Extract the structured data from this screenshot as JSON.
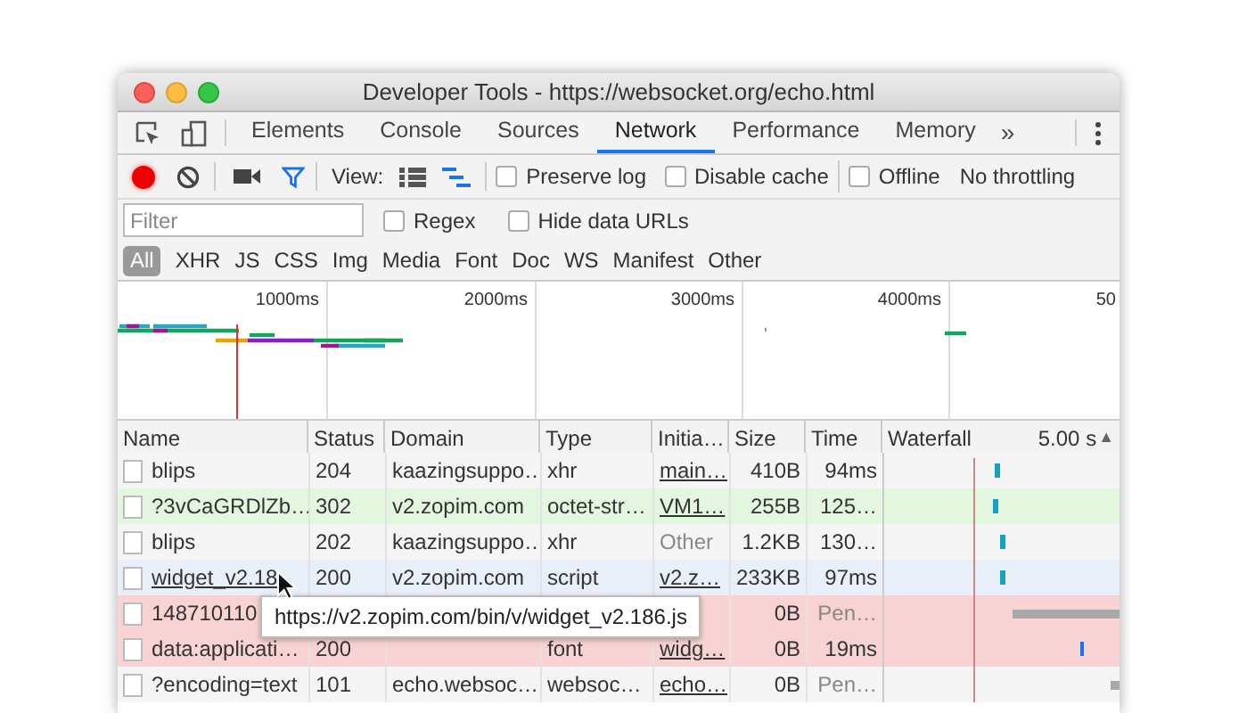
{
  "window": {
    "title": "Developer Tools - https://websocket.org/echo.html"
  },
  "tabs": [
    {
      "label": "Elements",
      "selected": false
    },
    {
      "label": "Console",
      "selected": false
    },
    {
      "label": "Sources",
      "selected": false
    },
    {
      "label": "Network",
      "selected": true
    },
    {
      "label": "Performance",
      "selected": false
    },
    {
      "label": "Memory",
      "selected": false
    }
  ],
  "more_tabs": "»",
  "toolbar": {
    "recording": true,
    "filter_on": true,
    "view_label": "View:",
    "large_rows": false,
    "overview": true,
    "checkboxes": [
      {
        "label": "Preserve log",
        "checked": false
      },
      {
        "label": "Disable cache",
        "checked": false
      },
      {
        "label": "Offline",
        "checked": false
      }
    ],
    "throttling": "No throttling"
  },
  "filter": {
    "placeholder": "Filter",
    "options": [
      {
        "label": "Regex",
        "checked": false
      },
      {
        "label": "Hide data URLs",
        "checked": false
      }
    ],
    "types": [
      {
        "label": "All",
        "selected": true
      },
      {
        "label": "XHR",
        "selected": false
      },
      {
        "label": "JS",
        "selected": false
      },
      {
        "label": "CSS",
        "selected": false
      },
      {
        "label": "Img",
        "selected": false
      },
      {
        "label": "Media",
        "selected": false
      },
      {
        "label": "Font",
        "selected": false
      },
      {
        "label": "Doc",
        "selected": false
      },
      {
        "label": "WS",
        "selected": false
      },
      {
        "label": "Manifest",
        "selected": false
      },
      {
        "label": "Other",
        "selected": false
      }
    ]
  },
  "overview": {
    "ticks": [
      "1000ms",
      "2000ms",
      "3000ms",
      "4000ms",
      "50"
    ]
  },
  "table": {
    "columns": [
      "Name",
      "Status",
      "Domain",
      "Type",
      "Initia…",
      "Size",
      "Time",
      "Waterfall"
    ],
    "waterfall_scale": "5.00 s",
    "sort_mark": "▲",
    "rows": [
      {
        "name": "blips",
        "status": "204",
        "domain": "kaazingsuppo…",
        "type": "xhr",
        "initiator": "main…",
        "initiator_link": true,
        "size": "410B",
        "time": "94ms",
        "kind": "normal",
        "hovered": false,
        "pending": false
      },
      {
        "name": "?3vCaGRDlZb…",
        "status": "302",
        "domain": "v2.zopim.com",
        "type": "octet-str…",
        "initiator": "VM1…",
        "initiator_link": true,
        "size": "255B",
        "time": "125…",
        "kind": "redirect",
        "hovered": false,
        "pending": false
      },
      {
        "name": "blips",
        "status": "202",
        "domain": "kaazingsuppo…",
        "type": "xhr",
        "initiator": "Other",
        "initiator_link": false,
        "size": "1.2KB",
        "time": "130…",
        "kind": "normal",
        "hovered": false,
        "pending": false
      },
      {
        "name": "widget_v2.18",
        "status": "200",
        "domain": "v2.zopim.com",
        "type": "script",
        "initiator": "v2.z…",
        "initiator_link": true,
        "size": "233KB",
        "time": "97ms",
        "kind": "normal",
        "hovered": true,
        "pending": false
      },
      {
        "name": "148710110",
        "size": "0B",
        "time": "Pen…",
        "kind": "error",
        "hovered": false,
        "pending": true
      },
      {
        "name": "data:applicati…",
        "status": "200",
        "type": "font",
        "initiator": "widg…",
        "initiator_link": true,
        "size": "0B",
        "time": "19ms",
        "kind": "error",
        "hovered": false,
        "pending": false
      },
      {
        "name": "?encoding=text",
        "status": "101",
        "domain": "echo.websoc…",
        "type": "websoc…",
        "initiator": "echo…",
        "initiator_link": true,
        "size": "0B",
        "time": "Pen…",
        "kind": "normal",
        "hovered": false,
        "pending": true
      }
    ]
  },
  "tooltip": "https://v2.zopim.com/bin/v/widget_v2.186.js"
}
